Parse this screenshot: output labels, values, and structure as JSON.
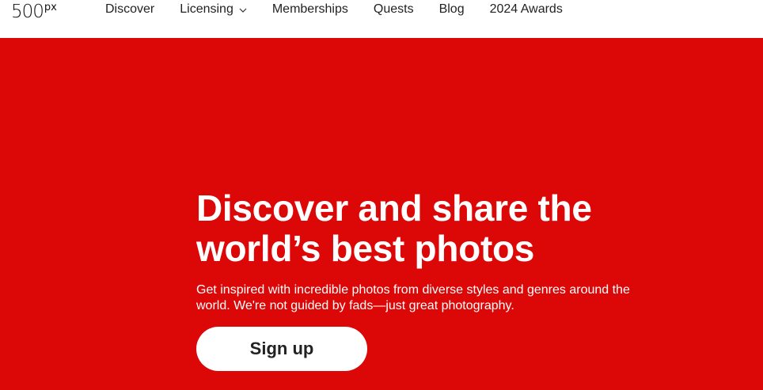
{
  "header": {
    "logo": {
      "number": "500",
      "suffix": "px"
    },
    "nav": [
      {
        "label": "Discover"
      },
      {
        "label": "Licensing",
        "icon": "chevron-down-icon"
      },
      {
        "label": "Memberships"
      },
      {
        "label": "Quests"
      },
      {
        "label": "Blog"
      },
      {
        "label": "2024 Awards"
      }
    ]
  },
  "hero": {
    "background_color": "#dc0707",
    "headline_line1": "Discover and share the",
    "headline_line2": "world’s best photos",
    "subtext_line1": "Get inspired with incredible photos from diverse styles and genres around the",
    "subtext_line2": "world. We're not guided by fads—just great photography.",
    "cta_label": "Sign up"
  }
}
